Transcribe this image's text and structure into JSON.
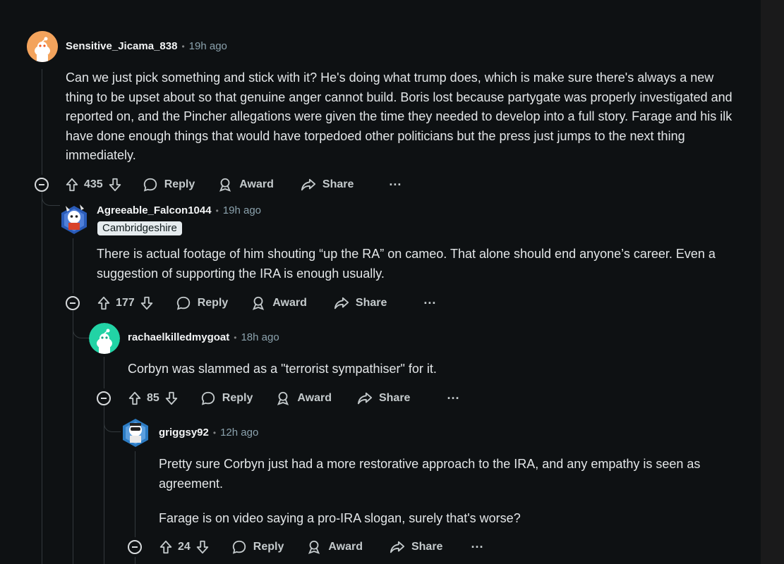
{
  "comments": [
    {
      "author": "Sensitive_Jicama_838",
      "time": "19h ago",
      "body": [
        "Can we just pick something and stick with it? He's doing what trump does, which is make sure there's always a new thing to be upset about so that genuine anger cannot build. Boris lost because partygate was properly investigated and reported on, and the Pincher allegations were given the time they needed to develop into a full story. Farage and his ilk have done enough things that would have torpedoed other politicians but the press just jumps to the next thing immediately."
      ],
      "votes": "435",
      "reply_label": "Reply",
      "award_label": "Award",
      "share_label": "Share",
      "more_label": "···",
      "avatar_color": "#f3a35c"
    },
    {
      "author": "Agreeable_Falcon1044",
      "time": "19h ago",
      "flair": "Cambridgeshire",
      "body": [
        "There is actual footage of him shouting “up the RA” on cameo. That alone should end anyone’s career. Even a suggestion of supporting the IRA is enough usually."
      ],
      "votes": "177",
      "reply_label": "Reply",
      "award_label": "Award",
      "share_label": "Share",
      "more_label": "···",
      "avatar_color": "#3b6fd4"
    },
    {
      "author": "rachaelkilledmygoat",
      "time": "18h ago",
      "body": [
        "Corbyn was slammed as a \"terrorist sympathiser\" for it."
      ],
      "votes": "85",
      "reply_label": "Reply",
      "award_label": "Award",
      "share_label": "Share",
      "more_label": "···",
      "avatar_color": "#22d3a5"
    },
    {
      "author": "griggsy92",
      "time": "12h ago",
      "body": [
        "Pretty sure Corbyn just had a more restorative approach to the IRA, and any empathy is seen as agreement.",
        "Farage is on video saying a pro-IRA slogan, surely that's worse?"
      ],
      "votes": "24",
      "reply_label": "Reply",
      "award_label": "Award",
      "share_label": "Share",
      "more_label": "···",
      "avatar_color": "#5b8fd6"
    }
  ]
}
